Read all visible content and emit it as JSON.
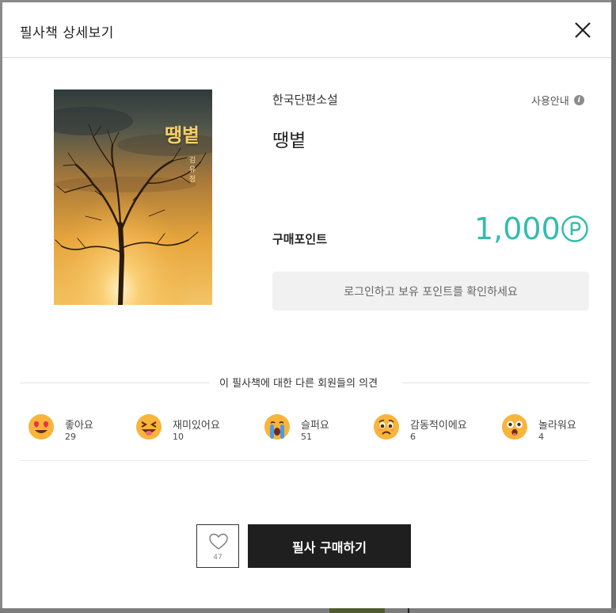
{
  "modal": {
    "title": "필사책 상세보기",
    "close_icon": "close-icon"
  },
  "book": {
    "category": "한국단편소설",
    "title": "땡볕",
    "cover_title": "땡볕",
    "cover_author": "김유정",
    "guide_label": "사용안내",
    "guide_icon": "info-icon",
    "points_label": "구매포인트",
    "points_value": "1,000",
    "points_icon": "P",
    "accent_color": "#35bcae",
    "login_prompt": "로그인하고 보유 포인트를 확인하세요"
  },
  "opinions": {
    "title": "이 필사책에 대한 다른 회원들의 의견",
    "reactions": [
      {
        "label": "좋아요",
        "count": "29",
        "icon": "heart-eyes-emoji-icon"
      },
      {
        "label": "재미있어요",
        "count": "10",
        "icon": "laughing-tongue-emoji-icon"
      },
      {
        "label": "슬퍼요",
        "count": "51",
        "icon": "crying-emoji-icon"
      },
      {
        "label": "감동적이에요",
        "count": "6",
        "icon": "teary-emoji-icon"
      },
      {
        "label": "놀라워요",
        "count": "4",
        "icon": "surprised-emoji-icon"
      }
    ]
  },
  "actions": {
    "like_count": "47",
    "like_icon": "heart-outline-icon",
    "buy_label": "필사 구매하기"
  }
}
